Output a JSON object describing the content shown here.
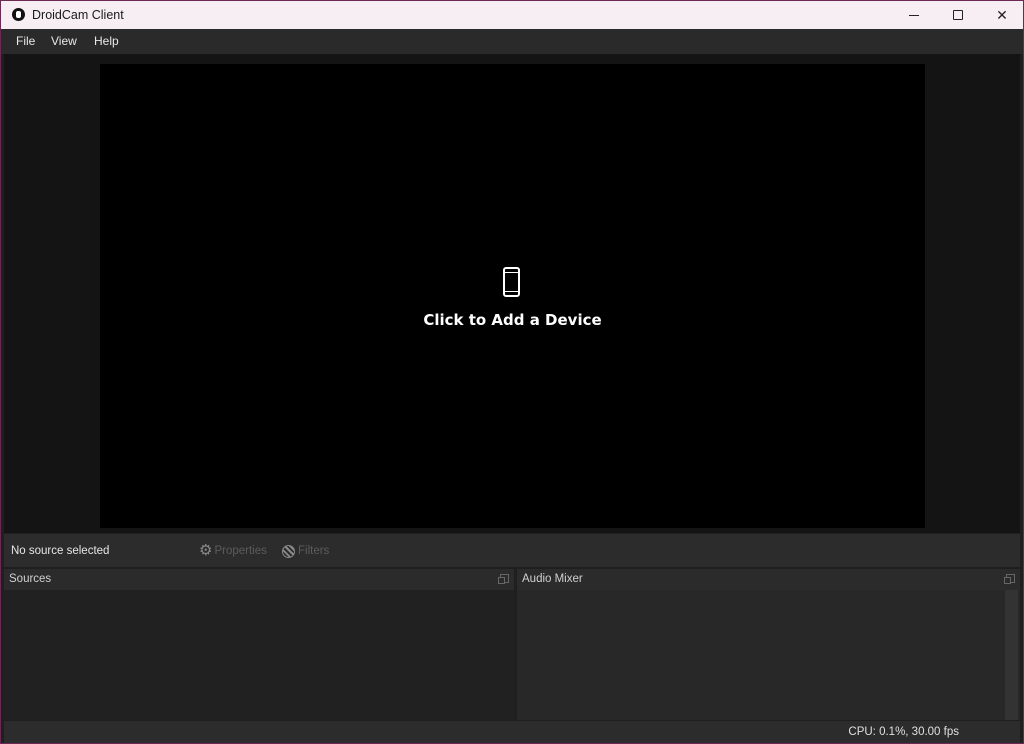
{
  "window": {
    "title": "DroidCam Client"
  },
  "menu": {
    "items": [
      "File",
      "View",
      "Help"
    ]
  },
  "preview": {
    "add_device_label": "Click to Add a Device",
    "icon": "phone-icon"
  },
  "source_bar": {
    "selected_source": "No source selected",
    "properties_label": "Properties",
    "filters_label": "Filters"
  },
  "docks": {
    "sources_title": "Sources",
    "audio_mixer_title": "Audio Mixer"
  },
  "status": {
    "text": "CPU: 0.1%, 30.00 fps"
  },
  "colors": {
    "titlebar": "#f6eef3",
    "background": "#1f1f1f",
    "preview": "#000000",
    "border_accent": "#6b2a52"
  }
}
